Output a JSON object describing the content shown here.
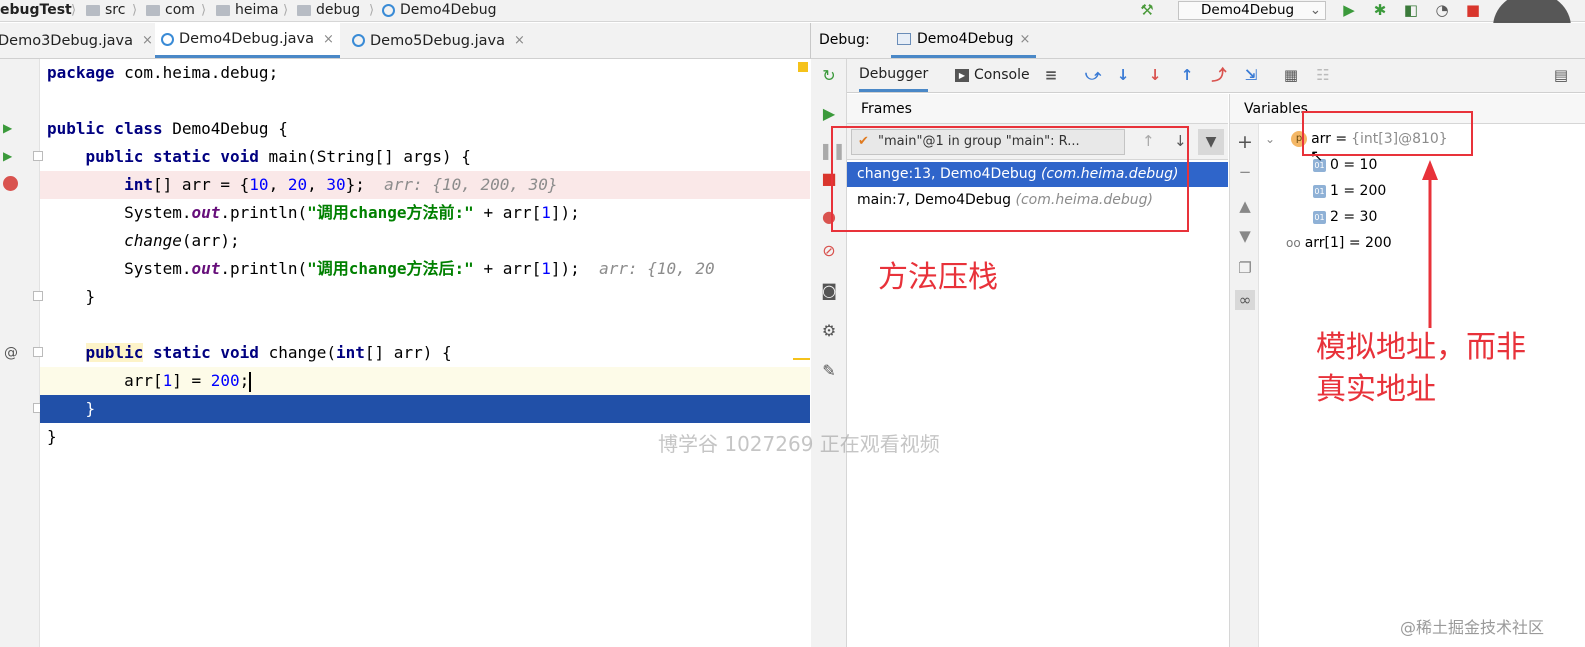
{
  "breadcrumb": {
    "project": "ebugTest",
    "items": [
      "src",
      "com",
      "heima",
      "debug",
      "Demo4Debug"
    ]
  },
  "toolbar": {
    "run_config": "Demo4Debug"
  },
  "editor": {
    "tabs": [
      {
        "label": "Demo3Debug.java",
        "close": "×"
      },
      {
        "label": "Demo4Debug.java",
        "close": "×"
      },
      {
        "label": "Demo5Debug.java",
        "close": "×"
      }
    ],
    "lines": [
      "package com.heima.debug;",
      "",
      "public class Demo4Debug {",
      "    public static void main(String[] args) {",
      "        int[] arr = {10, 20, 30};",
      "        System.out.println(\"调用change方法前:\" + arr[1]);",
      "        change(arr);",
      "        System.out.println(\"调用change方法后:\" + arr[1]);",
      "    }",
      "",
      "    public static void change(int[] arr) {",
      "        arr[1] = 200;",
      "    }",
      "}"
    ],
    "inline_hints": {
      "line5": "arr: {10, 200, 30}",
      "line8": "arr: {10, 20"
    }
  },
  "debug": {
    "title": "Debug:",
    "session": "Demo4Debug",
    "tabs": [
      "Debugger",
      "Console"
    ],
    "frames_header": "Frames",
    "variables_header": "Variables",
    "thread": "\"main\"@1 in group \"main\": R...",
    "frames": [
      {
        "method": "change:13, Demo4Debug",
        "pkg": "(com.heima.debug)"
      },
      {
        "method": "main:7, Demo4Debug",
        "pkg": "(com.heima.debug)"
      }
    ],
    "variables": {
      "arr_name": "arr =",
      "arr_value": "{int[3]@810}",
      "items": [
        "0 = 10",
        "1 = 200",
        "2 = 30"
      ],
      "watch": "arr[1] = 200"
    }
  },
  "annotations": {
    "stack": "方法压栈",
    "address_line1": "模拟地址，而非",
    "address_line2": "真实地址",
    "watermark": "博学谷 1027269 正在观看视频",
    "corner": "@稀土掘金技术社区"
  },
  "colors": {
    "annotation_red": "#e8323a",
    "selection_blue": "#2f65ca",
    "exec_line_blue": "#2150a8",
    "breakpoint_bg": "#fae8e8"
  }
}
